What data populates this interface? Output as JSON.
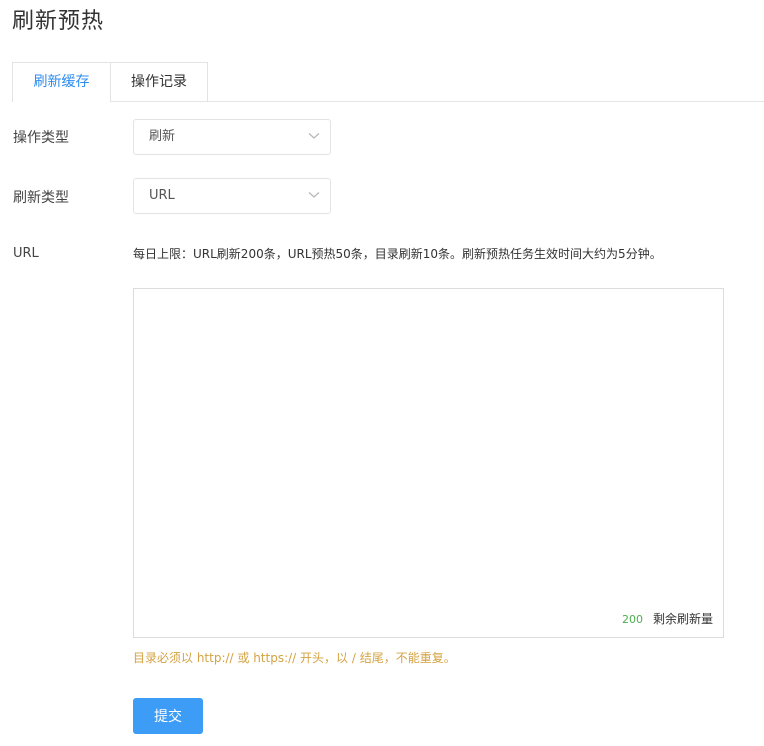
{
  "page": {
    "title": "刷新预热"
  },
  "tabs": [
    {
      "label": "刷新缓存",
      "active": true
    },
    {
      "label": "操作记录",
      "active": false
    }
  ],
  "form": {
    "operation_type": {
      "label": "操作类型",
      "value": "刷新"
    },
    "refresh_type": {
      "label": "刷新类型",
      "value": "URL"
    },
    "url": {
      "label": "URL",
      "hint": "每日上限：URL刷新200条，URL预热50条，目录刷新10条。刷新预热任务生效时间大约为5分钟。",
      "value": "",
      "remaining_count": "200",
      "remaining_label": "剩余刷新量",
      "warning": "目录必须以 http:// 或 https:// 开头，以 / 结尾，不能重复。"
    },
    "submit_label": "提交"
  },
  "colors": {
    "accent": "#2d8cf0",
    "button": "#3d9cf5",
    "warning": "#d4a344",
    "counter": "#4caf50"
  },
  "icons": {
    "select_arrow": "chevron-down-icon"
  }
}
